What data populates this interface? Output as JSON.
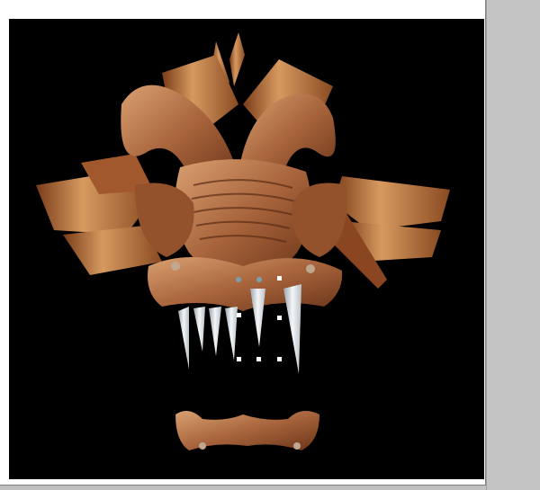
{
  "colors": {
    "background": "#c0c0c0",
    "canvas_frame": "#ffffff",
    "canvas": "#000000",
    "skin_light": "#d59a6a",
    "skin_mid": "#a5603a",
    "skin_dark": "#5a2c14",
    "tooth": "#e8ecef",
    "selection_handle": "#ffffff"
  },
  "icons": {
    "artwork": "dragon-head-texture-icon"
  }
}
